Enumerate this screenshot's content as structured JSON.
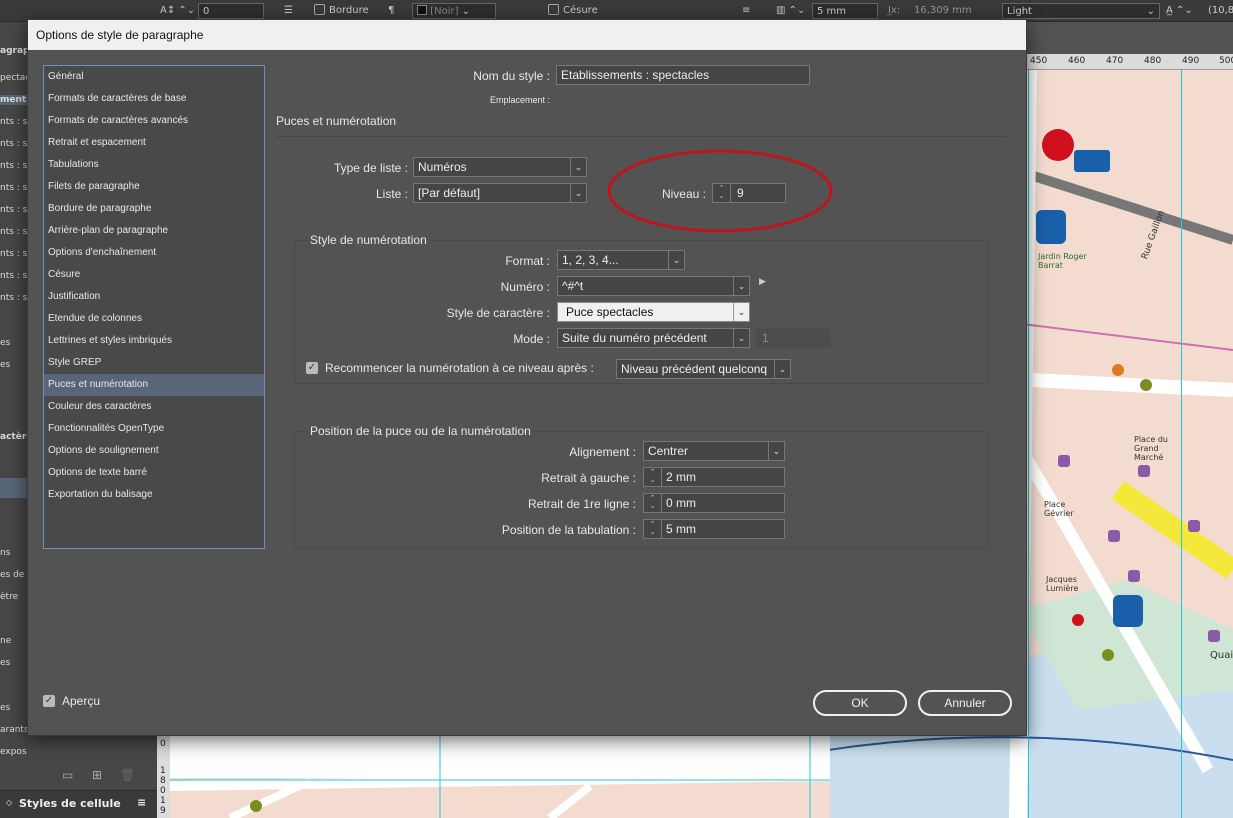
{
  "toolbar": {
    "zero_value": "0",
    "bordure_label": "Bordure",
    "noir_label": "[Noir]",
    "cesure_label": "Césure",
    "mm_value": "5 mm",
    "x_value": "16,309 mm",
    "font_weight": "Light",
    "right_value": "(10,8"
  },
  "left_panel": {
    "header": "agrap",
    "items": [
      "pectac",
      "ments",
      "nts : s",
      "nts : s",
      "nts : s",
      "nts : s",
      "nts : s",
      "nts : s",
      "nts : s",
      "nts : s",
      "nts : s",
      "es",
      "es",
      "actère",
      "ns",
      "es de th",
      "ètre",
      "ne",
      "es",
      "es",
      "arants",
      "expos"
    ],
    "bottom_label": "Styles de cellule"
  },
  "ruler": {
    "ticks": [
      "450",
      "460",
      "470",
      "480",
      "490",
      "500"
    ],
    "vticks": [
      "0",
      "1",
      "8",
      "0",
      "1",
      "9"
    ]
  },
  "map": {
    "labels": [
      "Jardin Roger Barrat",
      "Rue Gaillon",
      "Place du Grand Marché",
      "Jacques Lumière",
      "Place Gévrier",
      "Quai"
    ]
  },
  "dialog": {
    "title": "Options de style de paragraphe",
    "categories": [
      "Général",
      "Formats de caractères de base",
      "Formats de caractères avancés",
      "Retrait et espacement",
      "Tabulations",
      "Filets de paragraphe",
      "Bordure de paragraphe",
      "Arrière-plan de paragraphe",
      "Options d'enchaînement",
      "Césure",
      "Justification",
      "Etendue de colonnes",
      "Lettrines et styles imbriqués",
      "Style GREP",
      "Puces et numérotation",
      "Couleur des caractères",
      "Fonctionnalités OpenType",
      "Options de soulignement",
      "Options de texte barré",
      "Exportation du balisage"
    ],
    "selected_category": "Puces et numérotation",
    "style_name_label": "Nom du style :",
    "style_name_value": "Etablissements : spectacles",
    "location_label": "Emplacement :",
    "section_title": "Puces et numérotation",
    "list_type_label": "Type de liste :",
    "list_type_value": "Numéros",
    "list_label": "Liste :",
    "list_value": "[Par défaut]",
    "level_label": "Niveau :",
    "level_value": "9",
    "numbering_style_title": "Style de numérotation",
    "format_label": "Format :",
    "format_value": "1, 2, 3, 4...",
    "number_label": "Numéro :",
    "number_value": "^#^t",
    "char_style_label": "Style de caractère :",
    "char_style_value": "Puce spectacles",
    "mode_label": "Mode :",
    "mode_value": "Suite du numéro précédent",
    "mode_number": "1",
    "restart_label": "Recommencer la numérotation à ce niveau après :",
    "restart_value": "Niveau précédent quelconq",
    "position_title": "Position de la puce ou de la numérotation",
    "alignment_label": "Alignement :",
    "alignment_value": "Centrer",
    "left_indent_label": "Retrait à gauche :",
    "left_indent_value": "2 mm",
    "first_line_label": "Retrait de 1re ligne :",
    "first_line_value": "0 mm",
    "tab_pos_label": "Position de la tabulation :",
    "tab_pos_value": "5 mm",
    "preview_label": "Aperçu",
    "ok_label": "OK",
    "cancel_label": "Annuler"
  },
  "colors": {
    "dialog_bg": "#535353",
    "selection": "#59667a",
    "annotation_circle": "#c0141c",
    "map_bg": "#f3dccf",
    "map_water": "#c9dff0",
    "map_highlight": "#f5e83a"
  }
}
